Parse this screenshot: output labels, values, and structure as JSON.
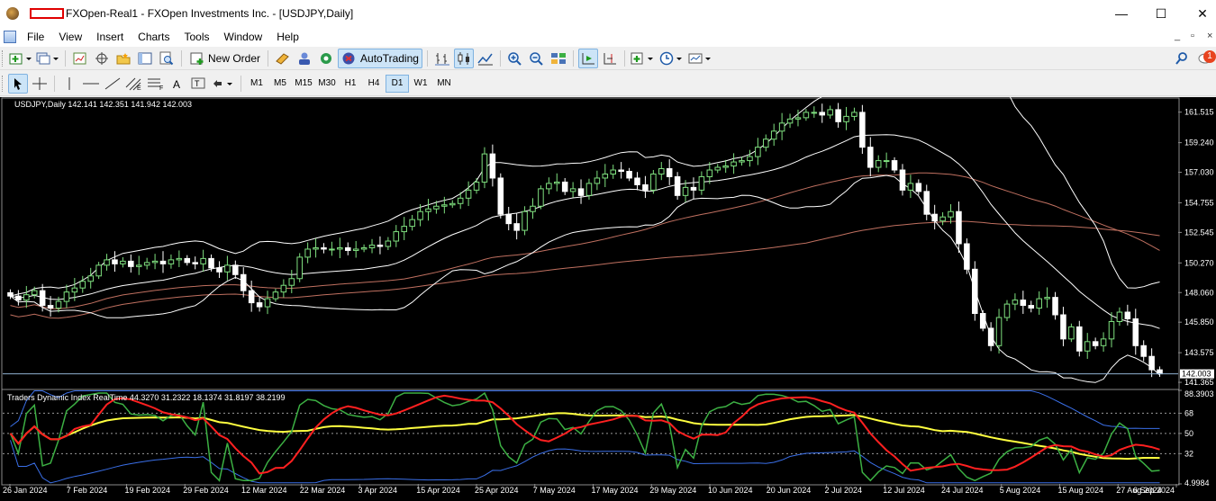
{
  "window": {
    "title": "FXOpen-Real1 - FXOpen Investments Inc. - [USDJPY,Daily]",
    "controls": [
      "—",
      "☐",
      "✕"
    ],
    "mdi_controls": [
      "_",
      "▫",
      "×"
    ]
  },
  "menu": [
    "File",
    "View",
    "Insert",
    "Charts",
    "Tools",
    "Window",
    "Help"
  ],
  "toolbar": {
    "new_order_label": "New Order",
    "autotrading_label": "AutoTrading",
    "notification_count": "1"
  },
  "timeframes": [
    "M1",
    "M5",
    "M15",
    "M30",
    "H1",
    "H4",
    "D1",
    "W1",
    "MN"
  ],
  "active_timeframe": "D1",
  "chart": {
    "header": "USDJPY,Daily  142.141 142.351 141.942 142.003",
    "current_price_label": "142.003",
    "indicator_header": "Traders Dynamic Index RealTime 44.3270 31.2322 18.1374 31.8197 38.2199",
    "colors": {
      "background": "#000000",
      "bull_candle": "#7fe07f",
      "bear_candle": "#ffffff",
      "bollinger": "#ffffff",
      "ma_slow": "#c07060",
      "price_line": "#8fb0d0",
      "tdi_bands": "#3a6fe8",
      "tdi_rsi": "#3cb043",
      "tdi_signal": "#ff2020",
      "tdi_base": "#ffff40"
    }
  },
  "chart_data": {
    "type": "candlestick",
    "symbol": "USDJPY",
    "timeframe": "Daily",
    "y_ticks": [
      "161.515",
      "159.240",
      "157.030",
      "154.755",
      "152.545",
      "150.270",
      "148.060",
      "145.850",
      "143.575",
      "141.365"
    ],
    "ylim": [
      140.9,
      162.5
    ],
    "x_ticks": [
      "26 Jan 2024",
      "7 Feb 2024",
      "19 Feb 2024",
      "29 Feb 2024",
      "12 Mar 2024",
      "22 Mar 2024",
      "3 Apr 2024",
      "15 Apr 2024",
      "25 Apr 2024",
      "7 May 2024",
      "17 May 2024",
      "29 May 2024",
      "10 Jun 2024",
      "20 Jun 2024",
      "2 Jul 2024",
      "12 Jul 2024",
      "24 Jul 2024",
      "5 Aug 2024",
      "15 Aug 2024",
      "27 Aug 2024",
      "6 Sep 2024"
    ],
    "close": [
      147.8,
      147.5,
      147.9,
      148.2,
      147.1,
      146.9,
      147.4,
      148.1,
      148.4,
      148.9,
      149.3,
      150.1,
      150.5,
      150.2,
      150.4,
      150.0,
      150.1,
      150.3,
      150.4,
      150.2,
      150.5,
      150.6,
      150.3,
      150.2,
      150.6,
      149.9,
      149.6,
      150.1,
      149.4,
      148.2,
      147.3,
      147.0,
      147.6,
      148.1,
      148.6,
      149.1,
      150.7,
      151.3,
      151.4,
      151.3,
      151.3,
      151.4,
      151.2,
      151.3,
      151.4,
      151.6,
      151.5,
      151.9,
      152.6,
      153.0,
      153.5,
      154.1,
      154.3,
      154.5,
      154.6,
      154.7,
      155.1,
      155.7,
      156.3,
      158.4,
      156.6,
      153.9,
      153.2,
      152.7,
      154.1,
      154.5,
      155.8,
      156.2,
      156.3,
      155.6,
      155.8,
      155.3,
      156.2,
      156.6,
      156.9,
      157.2,
      157.1,
      156.6,
      156.1,
      155.7,
      156.9,
      157.3,
      156.7,
      155.3,
      155.9,
      155.7,
      156.7,
      157.2,
      157.4,
      157.5,
      157.8,
      157.9,
      158.2,
      158.9,
      159.5,
      160.1,
      160.7,
      161.0,
      161.1,
      161.5,
      161.5,
      161.3,
      161.7,
      160.8,
      161.2,
      161.5,
      158.9,
      157.4,
      157.9,
      157.9,
      157.2,
      155.7,
      156.2,
      155.6,
      153.9,
      153.4,
      153.7,
      154.1,
      151.7,
      149.8,
      146.5,
      145.4,
      144.1,
      146.2,
      147.2,
      147.5,
      147.1,
      146.9,
      147.6,
      147.7,
      146.4,
      144.6,
      145.5,
      143.7,
      144.4,
      144.1,
      144.6,
      145.9,
      146.6,
      146.1,
      144.1,
      143.3,
      142.3,
      142.0
    ]
  },
  "indicator_data": {
    "name": "Traders Dynamic Index RealTime",
    "values": [
      44.327,
      31.2322,
      18.1374,
      31.8197,
      38.2199
    ],
    "y_ticks": [
      "88.3903",
      "68",
      "50",
      "32",
      "4.9984"
    ],
    "ylim": [
      4.9984,
      88.3903
    ],
    "levels": [
      68,
      50,
      32
    ]
  }
}
